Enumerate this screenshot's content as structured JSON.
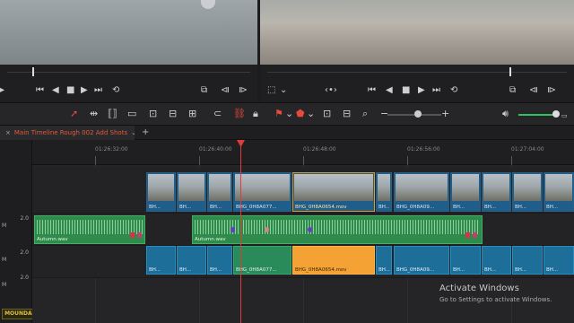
{
  "toolbar": {
    "tools": [
      "pointer-icon",
      "trim-icon",
      "dynamic-trim-icon",
      "blade-icon",
      "insert-icon",
      "overwrite-icon",
      "replace-icon",
      "snap-icon",
      "link-icon",
      "lock-icon",
      "flag-icon",
      "marker-icon",
      "zoom-full-icon",
      "zoom-detail-icon",
      "zoom-custom-icon",
      "volume-icon"
    ]
  },
  "timeline_tab": {
    "name": "Main Timeline Rough 002 Add Shots",
    "close": "×",
    "dropdown": "⌄",
    "add": "+"
  },
  "ruler": {
    "labels": [
      "01:26:32:00",
      "01:26:40:00",
      "01:26:48:00",
      "01:26:56:00",
      "01:27:04:00"
    ]
  },
  "tracks": {
    "a1": {
      "level": "2.0",
      "mute": "M"
    },
    "a2": {
      "level": "2.0",
      "mute": "M"
    },
    "a3": {
      "level": "2.0",
      "mute": "M"
    }
  },
  "video_clips": [
    {
      "label": "BH..."
    },
    {
      "label": "BH..."
    },
    {
      "label": "BH..."
    },
    {
      "label": "BHG_0H8A077..."
    },
    {
      "label": "BHG_0H8A0654.mov"
    },
    {
      "label": "BH..."
    },
    {
      "label": "BHG_0H8A09..."
    },
    {
      "label": "BH..."
    },
    {
      "label": "BH..."
    },
    {
      "label": "BH..."
    },
    {
      "label": "BH..."
    }
  ],
  "audio_clips": [
    {
      "label": "Autumn.wav"
    },
    {
      "label": "Autumn.wav"
    }
  ],
  "audio2_clips": [
    {
      "label": "BH..."
    },
    {
      "label": "BH..."
    },
    {
      "label": "BH..."
    },
    {
      "label": "BHG_0H8A077..."
    },
    {
      "label": "BHG_0H8A0654.mov"
    },
    {
      "label": "BH..."
    },
    {
      "label": "BHG_0H8A09..."
    },
    {
      "label": "BH..."
    },
    {
      "label": "BH..."
    },
    {
      "label": "BH..."
    },
    {
      "label": "BH..."
    }
  ],
  "watermark": {
    "title": "Activate Windows",
    "subtitle": "Go to Settings to activate Windows."
  },
  "logo": "MOUNDAIN",
  "colors": {
    "playhead": "#e03a3a",
    "selected_clip": "#f4a233",
    "video_clip": "#1f5e8a",
    "audio_clip": "#2f8a4c"
  }
}
